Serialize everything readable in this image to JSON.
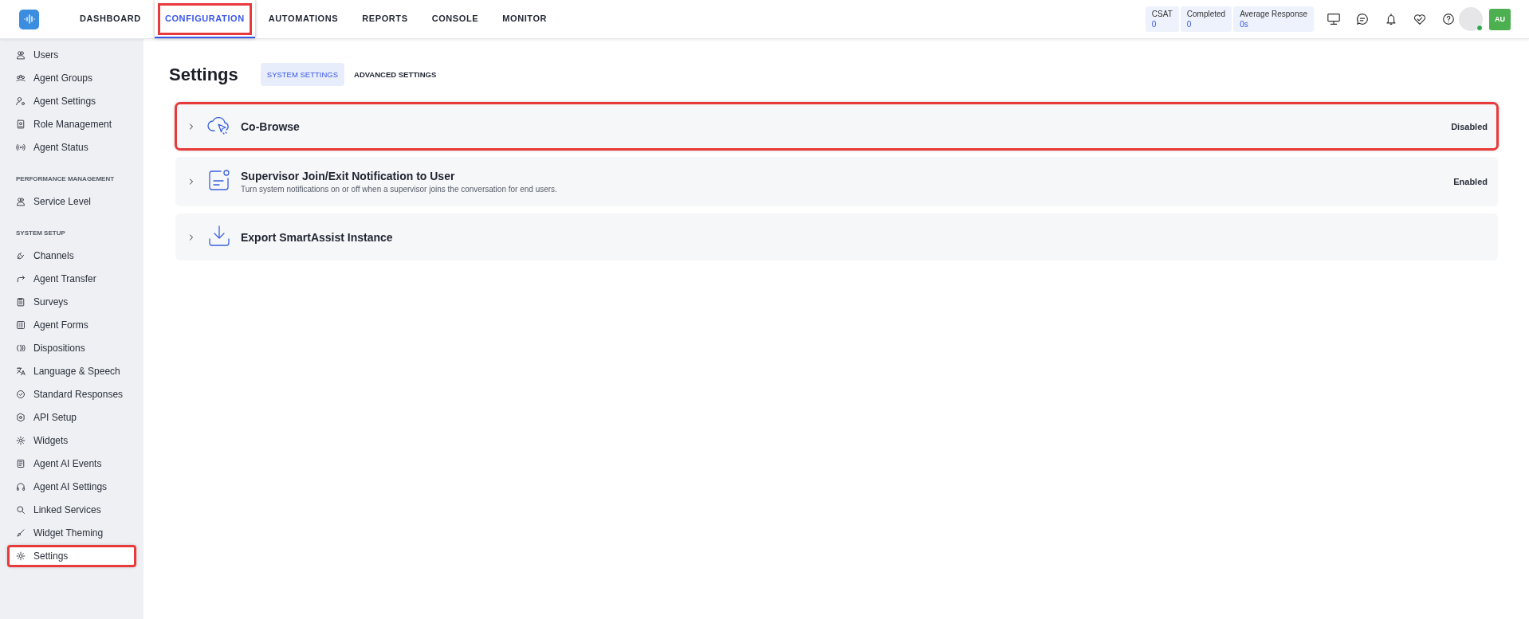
{
  "app_bar": {
    "nav": [
      {
        "label": "DASHBOARD",
        "selected": false,
        "highlighted": false
      },
      {
        "label": "CONFIGURATION",
        "selected": true,
        "highlighted": true
      },
      {
        "label": "AUTOMATIONS",
        "selected": false,
        "highlighted": false
      },
      {
        "label": "REPORTS",
        "selected": false,
        "highlighted": false
      },
      {
        "label": "CONSOLE",
        "selected": false,
        "highlighted": false
      },
      {
        "label": "MONITOR",
        "selected": false,
        "highlighted": false
      }
    ],
    "stats": [
      {
        "label": "CSAT",
        "value": "0"
      },
      {
        "label": "Completed",
        "value": "0"
      },
      {
        "label": "Average Response",
        "value": "0s"
      }
    ],
    "user": {
      "initials": "AU",
      "online": true
    }
  },
  "sidebar": {
    "sections": [
      {
        "items": [
          {
            "label": "Users",
            "selected": false,
            "highlighted": false
          },
          {
            "label": "Agent Groups",
            "selected": false,
            "highlighted": false
          },
          {
            "label": "Agent Settings",
            "selected": false,
            "highlighted": false
          },
          {
            "label": "Role Management",
            "selected": false,
            "highlighted": false
          },
          {
            "label": "Agent Status",
            "selected": false,
            "highlighted": false
          }
        ]
      },
      {
        "heading": "PERFORMANCE MANAGEMENT",
        "items": [
          {
            "label": "Service Level",
            "selected": false,
            "highlighted": false
          }
        ]
      },
      {
        "heading": "SYSTEM SETUP",
        "items": [
          {
            "label": "Channels",
            "selected": false,
            "highlighted": false
          },
          {
            "label": "Agent Transfer",
            "selected": false,
            "highlighted": false
          },
          {
            "label": "Surveys",
            "selected": false,
            "highlighted": false
          },
          {
            "label": "Agent Forms",
            "selected": false,
            "highlighted": false
          },
          {
            "label": "Dispositions",
            "selected": false,
            "highlighted": false
          },
          {
            "label": "Language & Speech",
            "selected": false,
            "highlighted": false
          },
          {
            "label": "Standard Responses",
            "selected": false,
            "highlighted": false
          },
          {
            "label": "API Setup",
            "selected": false,
            "highlighted": false
          },
          {
            "label": "Widgets",
            "selected": false,
            "highlighted": false
          },
          {
            "label": "Agent AI Events",
            "selected": false,
            "highlighted": false
          },
          {
            "label": "Agent AI Settings",
            "selected": false,
            "highlighted": false
          },
          {
            "label": "Linked Services",
            "selected": false,
            "highlighted": false
          },
          {
            "label": "Widget Theming",
            "selected": false,
            "highlighted": false
          },
          {
            "label": "Settings",
            "selected": true,
            "highlighted": true
          }
        ]
      }
    ]
  },
  "page": {
    "title": "Settings",
    "tabs": [
      {
        "label": "SYSTEM SETTINGS",
        "selected": true
      },
      {
        "label": "ADVANCED SETTINGS",
        "selected": false
      }
    ],
    "settings": [
      {
        "title": "Co-Browse",
        "status": "Disabled",
        "expanded": false,
        "highlighted": true
      },
      {
        "title": "Supervisor Join/Exit Notification to User",
        "description": "Turn system notifications on or off when a supervisor joins the conversation for end users.",
        "status": "Enabled",
        "expanded": false,
        "highlighted": false
      },
      {
        "title": "Export SmartAssist Instance",
        "expanded": false,
        "highlighted": false
      }
    ]
  }
}
